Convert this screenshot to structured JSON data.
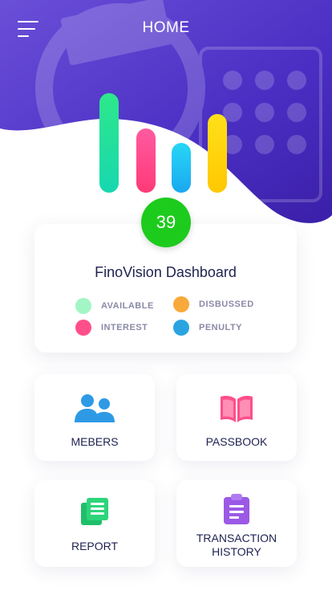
{
  "header": {
    "title": "HOME",
    "menu_icon": "hamburger-menu-icon"
  },
  "logo": {
    "bars": [
      {
        "color": "#2ee88a",
        "color2": "#18d7b0"
      },
      {
        "color": "#ff5aa0",
        "color2": "#ff3a78"
      },
      {
        "color": "#27d7f5",
        "color2": "#1aa8f0"
      },
      {
        "color": "#ffe01a",
        "color2": "#ffc800"
      }
    ]
  },
  "badge": {
    "count": "39",
    "color": "#1dcb1d"
  },
  "dashboard": {
    "title": "FinoVision Dashboard",
    "legend": [
      {
        "label": "AVAILABLE",
        "color": "#a3f5c6"
      },
      {
        "label": "DISBUSSED",
        "color": "#f7a93b"
      },
      {
        "label": "INTEREST",
        "color": "#ff4f8a"
      },
      {
        "label": "PENULTY",
        "color": "#2aa4e0"
      }
    ]
  },
  "tiles": {
    "members": {
      "label": "MEBERS",
      "icon": "users-icon",
      "color": "#2e9ae6"
    },
    "passbook": {
      "label": "PASSBOOK",
      "icon": "open-book-icon",
      "color": "#ff4f8a"
    },
    "report": {
      "label": "REPORT",
      "icon": "documents-icon",
      "color": "#2ed47a"
    },
    "history": {
      "label": "TRANSACTION HISTORY",
      "icon": "clipboard-list-icon",
      "color": "#9b59e6"
    }
  },
  "colors": {
    "hero": "#4b2fc4",
    "hero_dark": "#3a1fa8"
  }
}
